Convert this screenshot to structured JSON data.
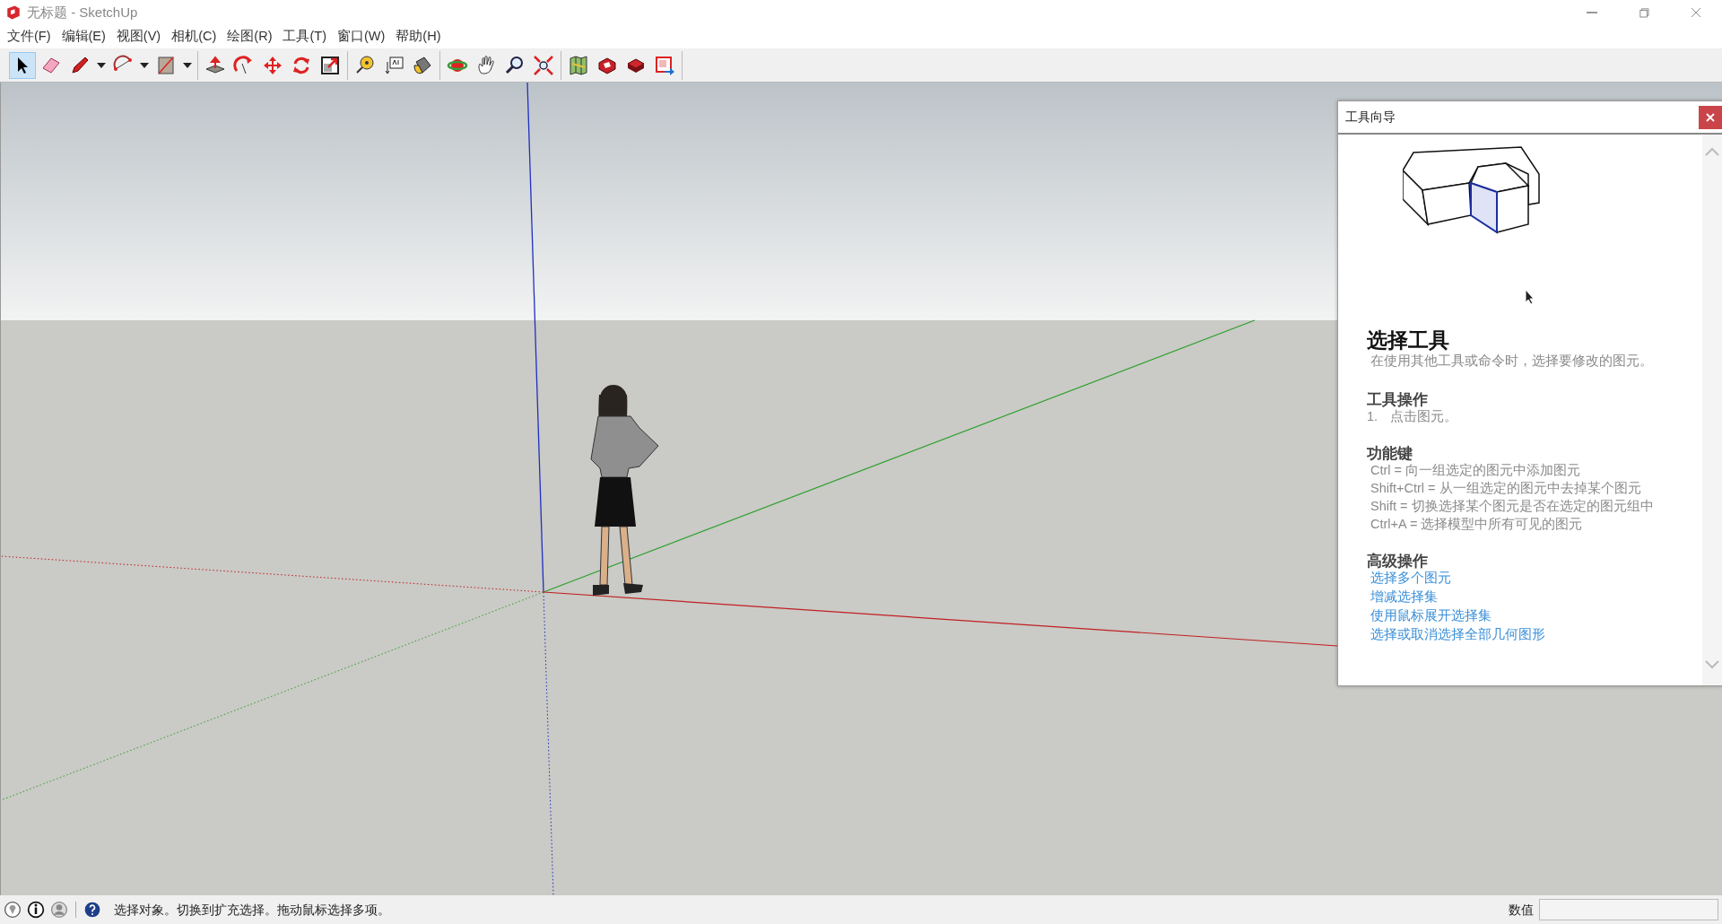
{
  "window": {
    "title": "无标题 - SketchUp"
  },
  "menu": [
    "文件(F)",
    "编辑(E)",
    "视图(V)",
    "相机(C)",
    "绘图(R)",
    "工具(T)",
    "窗口(W)",
    "帮助(H)"
  ],
  "toolbar": [
    [
      {
        "selected": true,
        "dropdown": false
      },
      {
        "selected": false,
        "dropdown": false
      },
      {
        "selected": false,
        "dropdown": true
      },
      {
        "selected": false,
        "dropdown": true
      },
      {
        "selected": false,
        "dropdown": true
      }
    ],
    [
      {
        "selected": false,
        "dropdown": false
      },
      {
        "selected": false,
        "dropdown": false
      },
      {
        "selected": false,
        "dropdown": false
      },
      {
        "selected": false,
        "dropdown": false
      },
      {
        "selected": false,
        "dropdown": false
      }
    ],
    [
      {
        "selected": false,
        "dropdown": false
      },
      {
        "selected": false,
        "dropdown": false
      },
      {
        "selected": false,
        "dropdown": false
      }
    ],
    [
      {
        "selected": false,
        "dropdown": false
      },
      {
        "selected": false,
        "dropdown": false
      },
      {
        "selected": false,
        "dropdown": false
      },
      {
        "selected": false,
        "dropdown": false
      }
    ],
    [
      {
        "selected": false,
        "dropdown": false
      },
      {
        "selected": false,
        "dropdown": false
      },
      {
        "selected": false,
        "dropdown": false
      },
      {
        "selected": false,
        "dropdown": false
      }
    ]
  ],
  "instructor": {
    "title": "工具向导",
    "heading": "选择工具",
    "description": "在使用其他工具或命令时，选择要修改的图元。",
    "sections": [
      {
        "kind": "steps",
        "heading": "工具操作",
        "items": [
          {
            "number": "1.",
            "text": "点击图元。"
          }
        ]
      },
      {
        "kind": "keys",
        "heading": "功能键",
        "items": [
          "Ctrl = 向一组选定的图元中添加图元",
          "Shift+Ctrl = 从一组选定的图元中去掉某个图元",
          "Shift = 切换选择某个图元是否在选定的图元组中",
          "Ctrl+A = 选择模型中所有可见的图元"
        ]
      },
      {
        "kind": "links",
        "heading": "高级操作",
        "items": [
          "选择多个图元",
          "增减选择集",
          "使用鼠标展开选择集",
          "选择或取消选择全部几何图形"
        ]
      }
    ]
  },
  "status_bar": {
    "message": "选择对象。切换到扩充选择。拖动鼠标选择多项。",
    "measurements_label": "数值"
  }
}
